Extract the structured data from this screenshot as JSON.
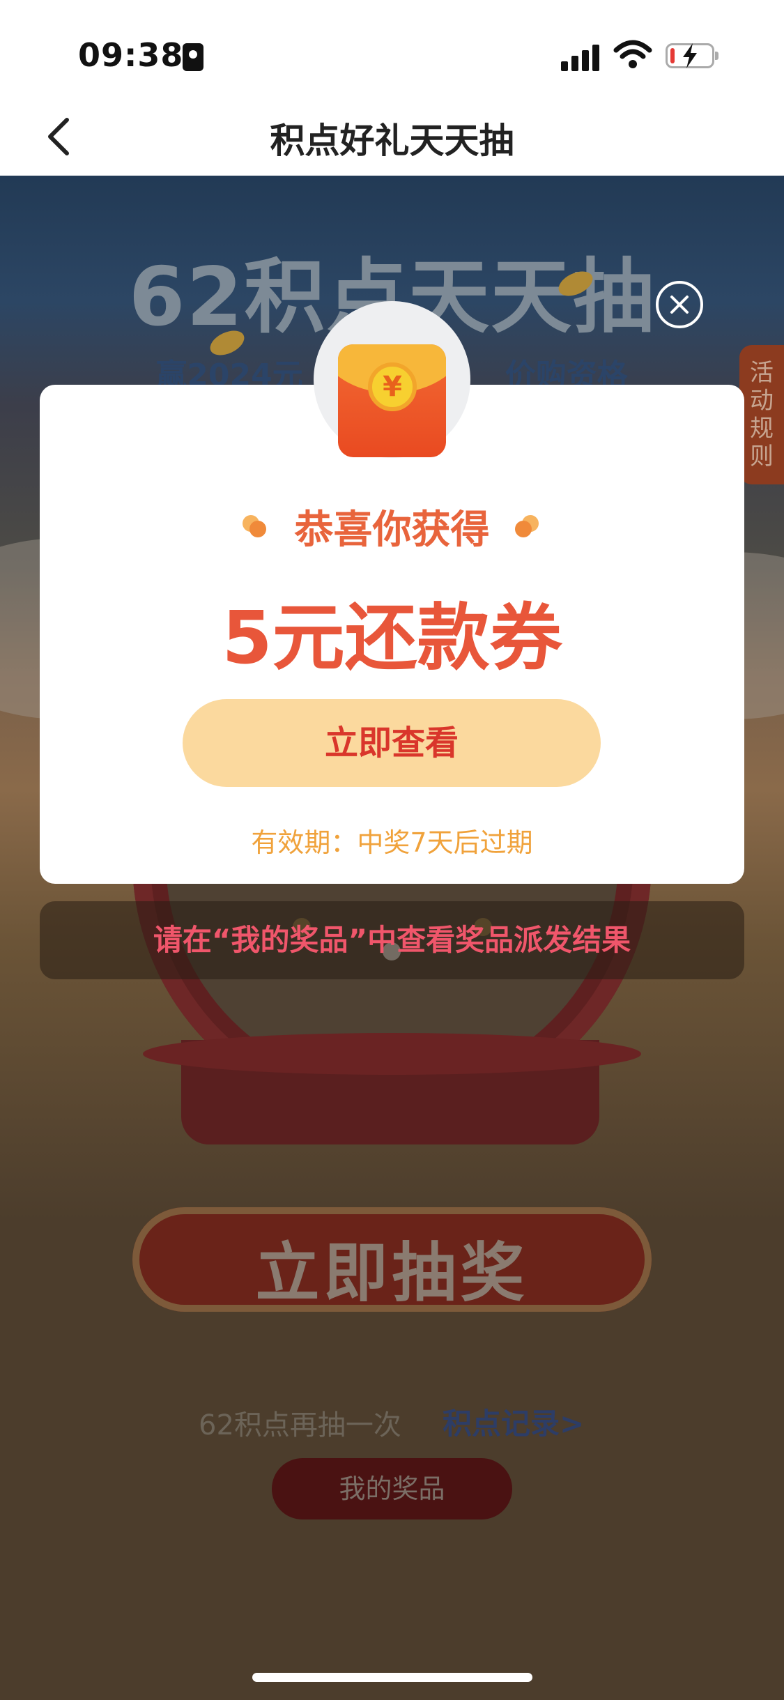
{
  "status_bar": {
    "time": "09:38"
  },
  "nav": {
    "title": "积点好礼天天抽"
  },
  "background": {
    "hero_title": "62积点天天抽",
    "hero_subtitle": "赢2024元",
    "hero_subtitle_right": "价购资格",
    "rules_tab": [
      "活",
      "动",
      "规",
      "则"
    ],
    "draw_button": "立即抽奖",
    "again_text": "62积点再抽一次",
    "points_record_link": "积点记录>",
    "my_prizes_button": "我的奖品"
  },
  "notice": {
    "text": "请在“我的奖品”中查看奖品派发结果"
  },
  "modal": {
    "congrats": "恭喜你获得",
    "prize": "5元还款券",
    "view_button": "立即查看",
    "validity": "有效期：中奖7天后过期",
    "yen_symbol": "¥"
  },
  "colors": {
    "accent_red": "#e8563a",
    "button_bg": "#fbd99e",
    "validity_orange": "#f0a23b",
    "notice_pink": "#f0566b"
  }
}
